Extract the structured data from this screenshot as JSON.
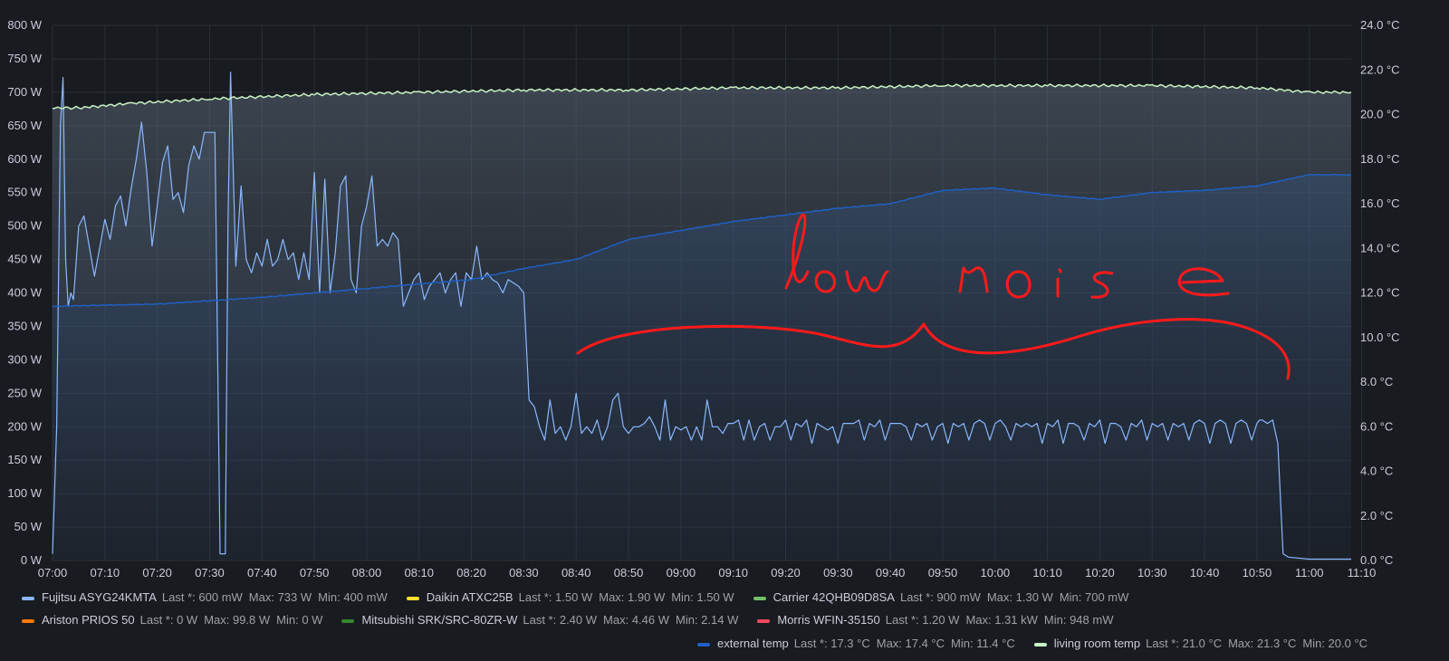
{
  "chart_data": {
    "type": "line",
    "x_ticks": [
      "07:00",
      "07:10",
      "07:20",
      "07:30",
      "07:40",
      "07:50",
      "08:00",
      "08:10",
      "08:20",
      "08:30",
      "08:40",
      "08:50",
      "09:00",
      "09:10",
      "09:20",
      "09:30",
      "09:40",
      "09:50",
      "10:00",
      "10:10",
      "10:20",
      "10:30",
      "10:40",
      "10:50",
      "11:00",
      "11:10"
    ],
    "xlim_minutes": [
      0,
      248
    ],
    "y_left": {
      "ticks": [
        "0 W",
        "50 W",
        "100 W",
        "150 W",
        "200 W",
        "250 W",
        "300 W",
        "350 W",
        "400 W",
        "450 W",
        "500 W",
        "550 W",
        "600 W",
        "650 W",
        "700 W",
        "750 W",
        "800 W"
      ],
      "ylim": [
        0,
        800
      ]
    },
    "y_right": {
      "ticks": [
        "0.0 °C",
        "2.0 °C",
        "4.0 °C",
        "6.0 °C",
        "8.0 °C",
        "10.0 °C",
        "12.0 °C",
        "14.0 °C",
        "16.0 °C",
        "18.0 °C",
        "20.0 °C",
        "22.0 °C",
        "24.0 °C"
      ],
      "ylim": [
        0,
        24
      ]
    },
    "grid": true,
    "series": [
      {
        "name": "Fujitsu ASYG24KMTA",
        "axis": "left",
        "color": "#8ab8ff",
        "x": [
          0,
          0.8,
          1.5,
          2,
          2.5,
          3,
          3.5,
          4,
          5,
          6,
          8,
          10,
          11,
          12,
          13,
          14,
          15,
          16,
          17,
          18,
          19,
          20,
          21,
          22,
          23,
          24,
          25,
          26,
          27,
          28,
          29,
          30,
          31,
          32,
          33,
          33.5,
          34,
          35,
          36,
          37,
          38,
          39,
          40,
          41,
          42,
          43,
          44,
          45,
          46,
          47,
          48,
          49,
          50,
          51,
          52,
          53,
          54,
          55,
          56,
          57,
          58,
          59,
          60,
          61,
          62,
          63,
          64,
          65,
          66,
          67,
          68,
          69,
          70,
          71,
          72,
          73,
          74,
          75,
          76,
          77,
          78,
          79,
          80,
          81,
          82,
          83,
          84,
          85,
          86,
          87,
          88,
          89,
          90,
          91,
          92,
          93,
          94,
          95,
          96,
          97,
          98,
          99,
          100,
          101,
          102,
          103,
          104,
          105,
          106,
          107,
          108,
          109,
          110,
          111,
          112,
          113,
          114,
          115,
          116,
          117,
          118,
          119,
          120,
          121,
          122,
          123,
          124,
          125,
          126,
          127,
          128,
          129,
          130,
          131,
          132,
          133,
          134,
          135,
          136,
          137,
          138,
          139,
          140,
          141,
          142,
          143,
          144,
          145,
          146,
          147,
          148,
          149,
          150,
          151,
          152,
          153,
          154,
          155,
          156,
          157,
          158,
          159,
          160,
          161,
          162,
          163,
          164,
          165,
          166,
          167,
          168,
          169,
          170,
          171,
          172,
          173,
          174,
          175,
          176,
          177,
          178,
          179,
          180,
          181,
          182,
          183,
          184,
          185,
          186,
          187,
          188,
          189,
          190,
          191,
          192,
          193,
          194,
          195,
          196,
          197,
          198,
          199,
          200,
          201,
          202,
          203,
          204,
          205,
          206,
          207,
          208,
          209,
          210,
          211,
          212,
          213,
          214,
          215,
          216,
          217,
          218,
          219,
          220,
          221,
          222,
          223,
          224,
          225,
          226,
          227,
          228,
          229,
          230,
          230.5,
          231,
          232,
          233,
          234,
          235,
          236,
          240,
          245,
          248
        ],
        "y": [
          10,
          200,
          650,
          722,
          450,
          380,
          400,
          390,
          500,
          515,
          425,
          510,
          480,
          530,
          545,
          500,
          555,
          600,
          655,
          580,
          470,
          530,
          595,
          620,
          540,
          550,
          520,
          590,
          620,
          600,
          640,
          640,
          640,
          10,
          10,
          500,
          730,
          440,
          560,
          450,
          430,
          460,
          440,
          480,
          440,
          450,
          480,
          450,
          460,
          420,
          460,
          420,
          580,
          400,
          570,
          400,
          460,
          560,
          575,
          420,
          400,
          500,
          530,
          575,
          470,
          480,
          470,
          490,
          480,
          380,
          400,
          420,
          430,
          390,
          410,
          420,
          430,
          400,
          420,
          430,
          380,
          430,
          420,
          470,
          420,
          430,
          420,
          415,
          400,
          420,
          415,
          410,
          400,
          240,
          230,
          200,
          180,
          240,
          190,
          200,
          180,
          200,
          250,
          190,
          200,
          190,
          210,
          180,
          200,
          240,
          250,
          200,
          190,
          200,
          200,
          205,
          215,
          200,
          180,
          240,
          180,
          200,
          195,
          200,
          180,
          200,
          180,
          240,
          200,
          200,
          190,
          205,
          205,
          210,
          180,
          210,
          180,
          200,
          205,
          180,
          200,
          200,
          210,
          180,
          205,
          200,
          210,
          175,
          205,
          200,
          195,
          200,
          175,
          205,
          205,
          205,
          210,
          180,
          205,
          200,
          210,
          180,
          205,
          205,
          205,
          200,
          180,
          205,
          200,
          205,
          180,
          200,
          205,
          175,
          205,
          200,
          205,
          180,
          205,
          210,
          205,
          180,
          205,
          210,
          200,
          180,
          205,
          200,
          205,
          200,
          205,
          175,
          205,
          200,
          210,
          175,
          205,
          205,
          200,
          180,
          205,
          200,
          210,
          175,
          205,
          205,
          200,
          180,
          205,
          200,
          210,
          180,
          205,
          200,
          205,
          180,
          205,
          200,
          205,
          180,
          205,
          210,
          205,
          175,
          205,
          210,
          205,
          175,
          205,
          210,
          205,
          180,
          205,
          210,
          210,
          205,
          210,
          175,
          10,
          5,
          2,
          2,
          2
        ]
      },
      {
        "name": "Daikin ATXC25B",
        "axis": "left",
        "color": "#fade2a",
        "x": [],
        "y": []
      },
      {
        "name": "Carrier 42QHB09D8SA",
        "axis": "left",
        "color": "#73bf69",
        "x": [],
        "y": []
      },
      {
        "name": "Ariston PRIOS 50",
        "axis": "left",
        "color": "#ff780a",
        "x": [],
        "y": []
      },
      {
        "name": "Mitsubishi SRK/SRC-80ZR-W",
        "axis": "left",
        "color": "#37872d",
        "x": [],
        "y": []
      },
      {
        "name": "Morris WFIN-35150",
        "axis": "left",
        "color": "#f2495c",
        "x": [],
        "y": []
      },
      {
        "name": "external temp",
        "axis": "right",
        "color": "#1f60c4",
        "x": [
          0,
          20,
          40,
          60,
          80,
          90,
          100,
          110,
          120,
          130,
          140,
          150,
          160,
          170,
          180,
          190,
          200,
          210,
          220,
          230,
          240,
          248
        ],
        "y": [
          11.4,
          11.5,
          11.8,
          12.2,
          12.6,
          13.1,
          13.5,
          14.4,
          14.8,
          15.2,
          15.5,
          15.8,
          16.0,
          16.6,
          16.7,
          16.4,
          16.2,
          16.5,
          16.6,
          16.8,
          17.3,
          17.3
        ]
      },
      {
        "name": "living room temp",
        "axis": "right",
        "color": "#c8f2c2",
        "x": [
          0,
          5,
          15,
          30,
          50,
          70,
          90,
          110,
          130,
          150,
          170,
          190,
          210,
          230,
          240,
          248
        ],
        "y": [
          20.3,
          20.3,
          20.5,
          20.7,
          20.9,
          21.0,
          21.1,
          21.1,
          21.2,
          21.2,
          21.3,
          21.3,
          21.3,
          21.2,
          21.0,
          21.0
        ]
      }
    ],
    "annotation": {
      "text": "low noise",
      "color": "#ff1a1a"
    }
  },
  "legend": {
    "row1": [
      {
        "name": "Fujitsu ASYG24KMTA",
        "color": "#8ab8ff",
        "last": "Last *: 600 mW",
        "max": "Max: 733 W",
        "min": "Min: 400 mW"
      },
      {
        "name": "Daikin ATXC25B",
        "color": "#fade2a",
        "last": "Last *: 1.50 W",
        "max": "Max: 1.90 W",
        "min": "Min: 1.50 W"
      },
      {
        "name": "Carrier 42QHB09D8SA",
        "color": "#73bf69",
        "last": "Last *: 900 mW",
        "max": "Max: 1.30 W",
        "min": "Min: 700 mW"
      }
    ],
    "row2": [
      {
        "name": "Ariston PRIOS 50",
        "color": "#ff780a",
        "last": "Last *: 0 W",
        "max": "Max: 99.8 W",
        "min": "Min: 0 W"
      },
      {
        "name": "Mitsubishi SRK/SRC-80ZR-W",
        "color": "#37872d",
        "last": "Last *: 2.40 W",
        "max": "Max: 4.46 W",
        "min": "Min: 2.14 W"
      },
      {
        "name": "Morris WFIN-35150",
        "color": "#f2495c",
        "last": "Last *: 1.20 W",
        "max": "Max: 1.31 kW",
        "min": "Min: 948 mW"
      }
    ],
    "row3": [
      {
        "name": "external temp",
        "color": "#1f60c4",
        "last": "Last *: 17.3 °C",
        "max": "Max: 17.4 °C",
        "min": "Min: 11.4 °C"
      },
      {
        "name": "living room temp",
        "color": "#c8f2c2",
        "last": "Last *: 21.0 °C",
        "max": "Max: 21.3 °C",
        "min": "Min: 20.0 °C"
      }
    ]
  }
}
